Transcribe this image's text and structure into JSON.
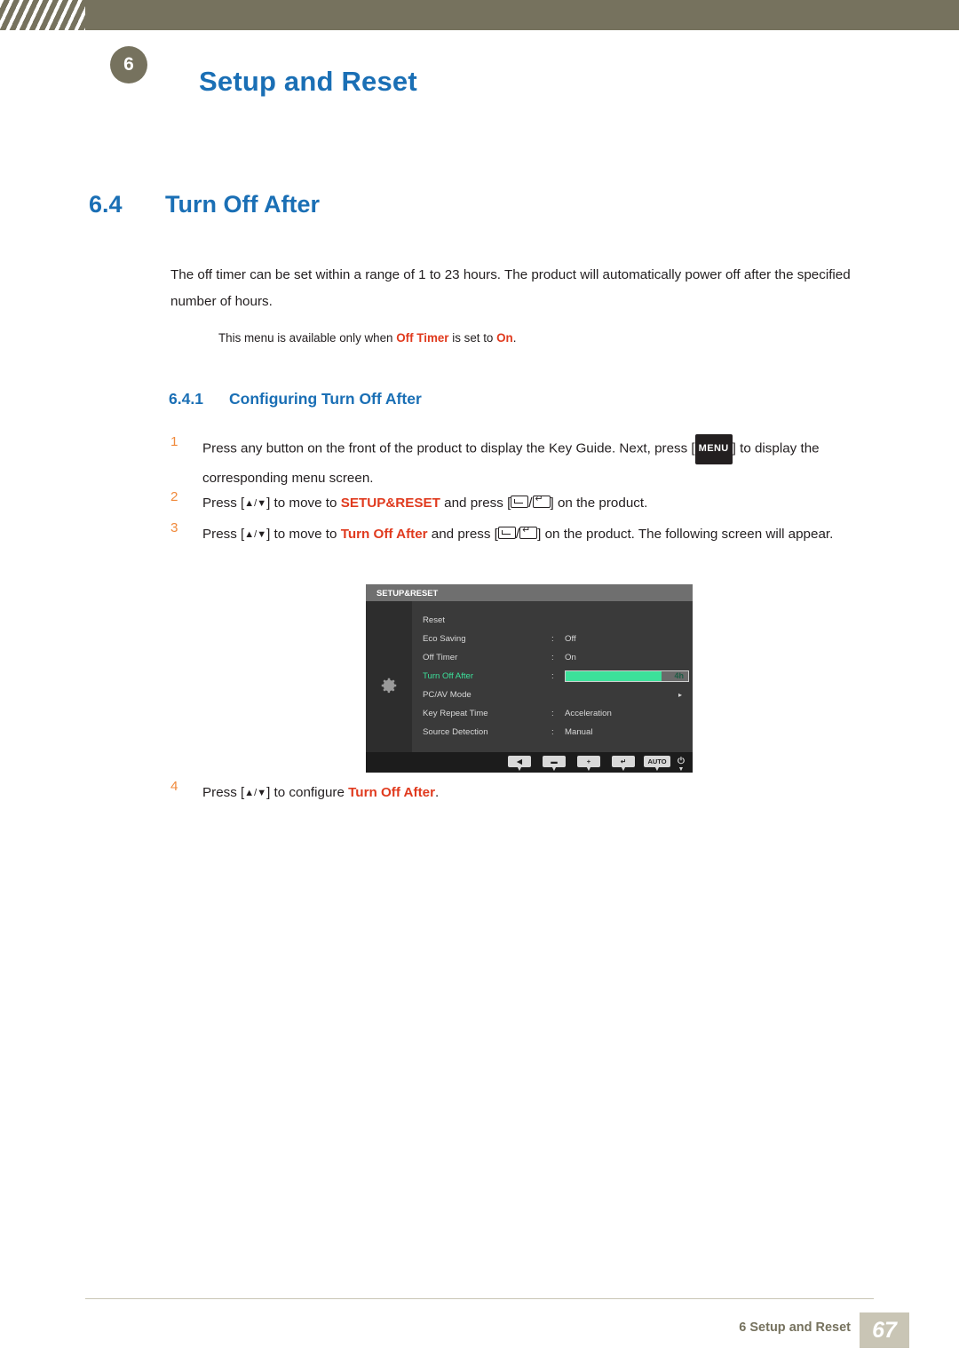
{
  "header": {
    "chapter_badge": "6",
    "title": "Setup and Reset"
  },
  "section": {
    "number": "6.4",
    "title": "Turn Off After",
    "intro": "The off timer can be set within a range of 1 to 23 hours. The product will automatically power off after the specified number of hours.",
    "note_pre": "This menu is available only when ",
    "note_hl1": "Off Timer",
    "note_mid": " is set to ",
    "note_hl2": "On",
    "note_post": "."
  },
  "subsection": {
    "number": "6.4.1",
    "title": "Configuring Turn Off After"
  },
  "steps": [
    {
      "num": "1",
      "a": "Press any button on the front of the product to display the Key Guide. Next, press [",
      "key": "MENU",
      "b": "] to display the corresponding menu screen."
    },
    {
      "num": "2",
      "a": "Press [",
      "arrows": "▲/▼",
      "b": "] to move to ",
      "hl": "SETUP&RESET",
      "c": " and press [",
      "d": "] on the product."
    },
    {
      "num": "3",
      "a": "Press [",
      "arrows": "▲/▼",
      "b": "] to move to ",
      "hl": "Turn Off After",
      "c": " and press [",
      "d": "] on the product. The following screen will appear."
    },
    {
      "num": "4",
      "a": "Press [",
      "arrows": "▲/▼",
      "b": "] to configure ",
      "hl": "Turn Off After",
      "c": "."
    }
  ],
  "osd": {
    "title": "SETUP&RESET",
    "rows": [
      {
        "label": "Reset",
        "colon": "",
        "value": ""
      },
      {
        "label": "Eco Saving",
        "colon": ":",
        "value": "Off"
      },
      {
        "label": "Off Timer",
        "colon": ":",
        "value": "On"
      },
      {
        "label": "Turn Off After",
        "colon": ":",
        "value": "4h",
        "slider": true,
        "slider_percent": 78,
        "selected": true
      },
      {
        "label": "PC/AV Mode",
        "colon": "",
        "value": "",
        "arrow": "▸"
      },
      {
        "label": "Key Repeat Time",
        "colon": ":",
        "value": "Acceleration"
      },
      {
        "label": "Source Detection",
        "colon": ":",
        "value": "Manual"
      }
    ],
    "scroll_caret": "▼",
    "footer_buttons": [
      {
        "glyph": "◀",
        "caret": "▼"
      },
      {
        "glyph": "▬",
        "caret": "▼"
      },
      {
        "glyph": "+",
        "caret": "▼"
      },
      {
        "glyph": "↵",
        "caret": "▼"
      },
      {
        "glyph": "AUTO",
        "caret": "▼"
      },
      {
        "glyph": "⏻",
        "caret": "▼"
      }
    ]
  },
  "footer": {
    "text": "6 Setup and Reset",
    "page": "67"
  },
  "colors": {
    "band": "#76725e",
    "heading_blue": "#1a6fb5",
    "highlight_red": "#e03a1e",
    "step_number": "#f08a3c",
    "osd_green": "#3ce09a"
  }
}
